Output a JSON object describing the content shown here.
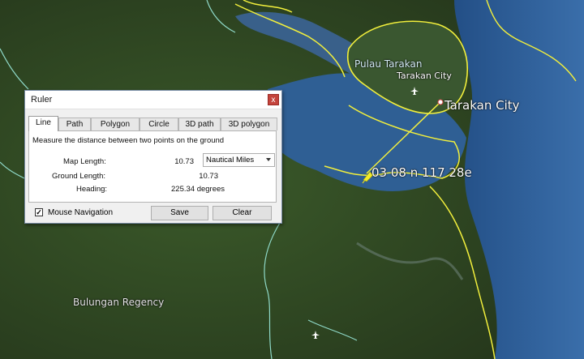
{
  "map": {
    "labels": {
      "island": "Pulau Tarakan",
      "town": "Tarakan City",
      "city": "Tarakan City",
      "coords": "03 08 n 117 28e",
      "regency": "Bulungan Regency"
    },
    "colors": {
      "border": "#f2ef3c",
      "boundary": "#8fd9c8",
      "measure_line": "#f3f040",
      "sea": "#2b5d9a",
      "land": "#2f4a1f"
    },
    "icons": [
      "airport-icon",
      "pushpin-icon",
      "city-marker-icon"
    ]
  },
  "dialog": {
    "title": "Ruler",
    "close_label": "x",
    "tabs": [
      {
        "label": "Line",
        "active": true
      },
      {
        "label": "Path",
        "active": false
      },
      {
        "label": "Polygon",
        "active": false
      },
      {
        "label": "Circle",
        "active": false
      },
      {
        "label": "3D path",
        "active": false
      },
      {
        "label": "3D polygon",
        "active": false
      }
    ],
    "description": "Measure the distance between two points on the ground",
    "map_length": {
      "label": "Map Length:",
      "value": "10.73"
    },
    "unit": {
      "selected": "Nautical Miles"
    },
    "ground_length": {
      "label": "Ground Length:",
      "value": "10.73"
    },
    "heading": {
      "label": "Heading:",
      "value": "225.34 degrees"
    },
    "mouse_navigation": {
      "label": "Mouse Navigation",
      "checked": true,
      "check_glyph": "✓"
    },
    "buttons": {
      "save": "Save",
      "clear": "Clear"
    }
  }
}
